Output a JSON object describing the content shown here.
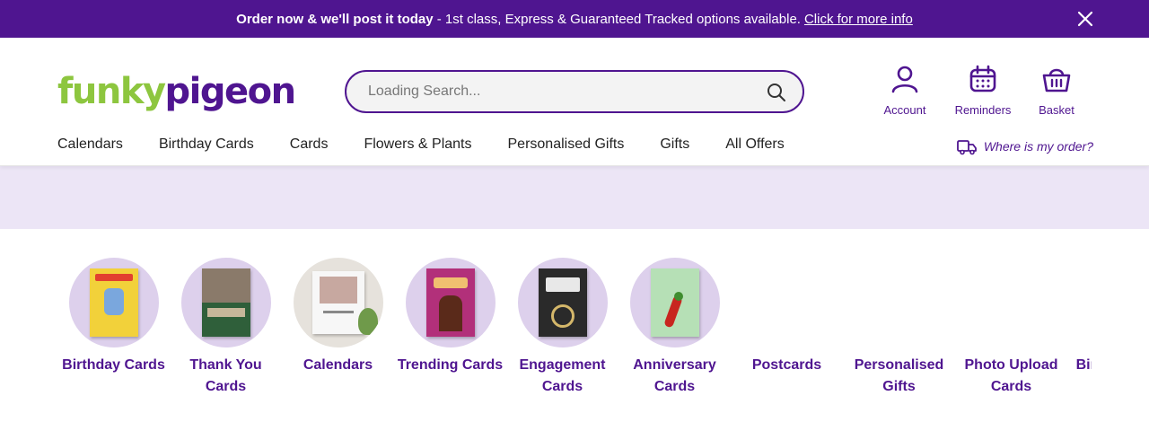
{
  "promo": {
    "bold_text": "Order now & we'll post it today",
    "text": " - 1st class, Express & Guaranteed Tracked options available.",
    "link": "Click for more info"
  },
  "logo": {
    "part1": "funky",
    "part2": "pigeon"
  },
  "search": {
    "placeholder": "Loading Search..."
  },
  "utils": {
    "account": "Account",
    "reminders": "Reminders",
    "basket": "Basket"
  },
  "nav": {
    "items": [
      "Calendars",
      "Birthday Cards",
      "Cards",
      "Flowers & Plants",
      "Personalised Gifts",
      "Gifts",
      "All Offers"
    ],
    "track": "Where is my order?"
  },
  "categories": [
    {
      "label": "Birthday Cards",
      "color": "#f2d13a"
    },
    {
      "label": "Thank You Cards",
      "color": "#2f5f3a"
    },
    {
      "label": "Calendars",
      "color": "#f4f4f4"
    },
    {
      "label": "Trending Cards",
      "color": "#b2307a"
    },
    {
      "label": "Engagement Cards",
      "color": "#2a2a2a"
    },
    {
      "label": "Anniversary Cards",
      "color": "#b6e0b6"
    },
    {
      "label": "Postcards",
      "color": ""
    },
    {
      "label": "Personalised Gifts",
      "color": ""
    },
    {
      "label": "Photo Upload Cards",
      "color": ""
    },
    {
      "label": "Birthday Gifts",
      "color": ""
    }
  ],
  "colors": {
    "brand": "#4f1590",
    "logo_green": "#8dc63f",
    "banner": "#ece5f6"
  }
}
